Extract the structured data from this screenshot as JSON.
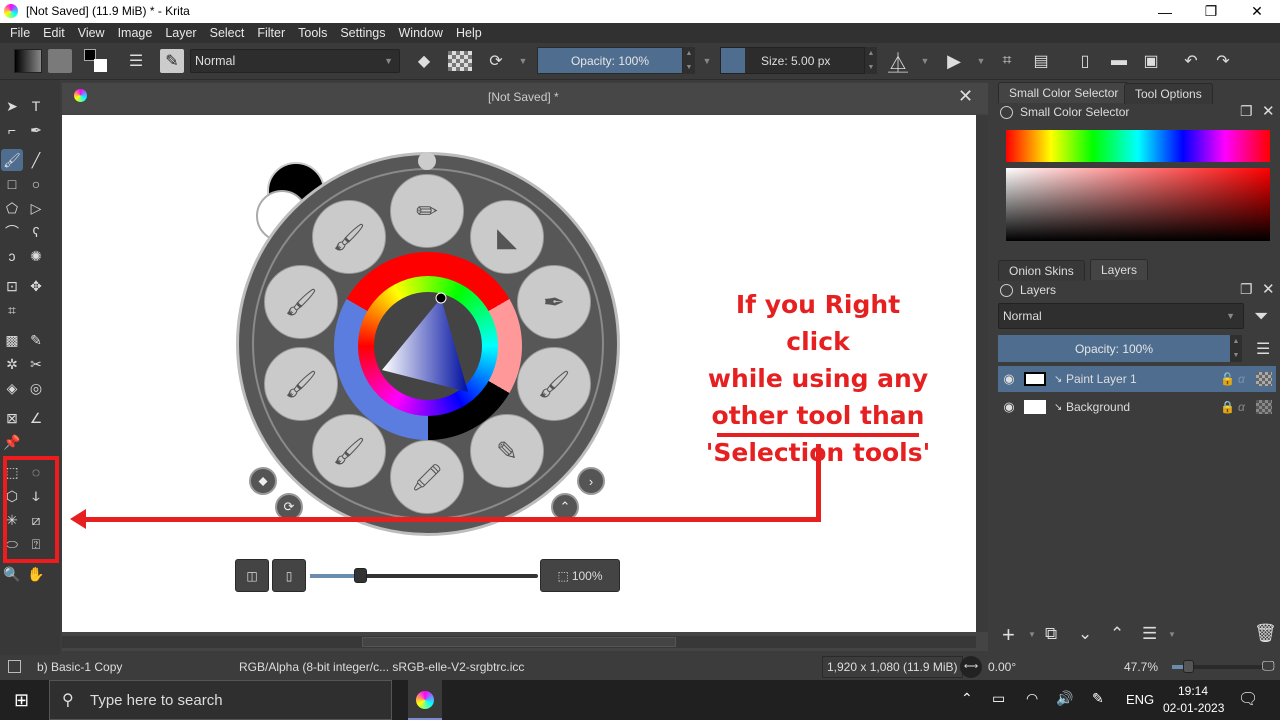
{
  "window": {
    "title": "[Not Saved]  (11.9 MiB)  * - Krita",
    "minimize": "—",
    "restore": "❐",
    "close": "✕"
  },
  "menu": [
    "File",
    "Edit",
    "View",
    "Image",
    "Layer",
    "Select",
    "Filter",
    "Tools",
    "Settings",
    "Window",
    "Help"
  ],
  "toolbar": {
    "blend_mode": "Normal",
    "opacity": "Opacity: 100%",
    "size": "Size: 5.00 px"
  },
  "document": {
    "tab_title": "[Not Saved]  *",
    "close": "✕"
  },
  "annotation": {
    "lines": [
      "If you Right click",
      "while using any",
      "other tool than",
      "'Selection tools'"
    ]
  },
  "palette_bar": {
    "zoom_label": "100%",
    "rotation_fraction": 0.22
  },
  "docker": {
    "top_tabs": [
      "Small Color Selector",
      "Tool Options"
    ],
    "color_selector_title": "Small Color Selector",
    "layer_tabs": [
      "Onion Skins",
      "Layers"
    ],
    "layers_title": "Layers",
    "layer_blend_mode": "Normal",
    "layer_opacity": "Opacity:  100%",
    "layers": [
      {
        "name": "Paint Layer 1",
        "active": true
      },
      {
        "name": "Background",
        "active": false
      }
    ]
  },
  "status": {
    "brush_preset": "b) Basic-1 Copy",
    "color_space": "RGB/Alpha (8-bit integer/c...  sRGB-elle-V2-srgbtrc.icc",
    "dimensions": "1,920 x 1,080 (11.9 MiB)",
    "rotation": "0.00°",
    "zoom": "47.7%"
  },
  "taskbar": {
    "search_placeholder": "Type here to search",
    "language": "ENG",
    "time": "19:14",
    "date": "02-01-2023"
  }
}
